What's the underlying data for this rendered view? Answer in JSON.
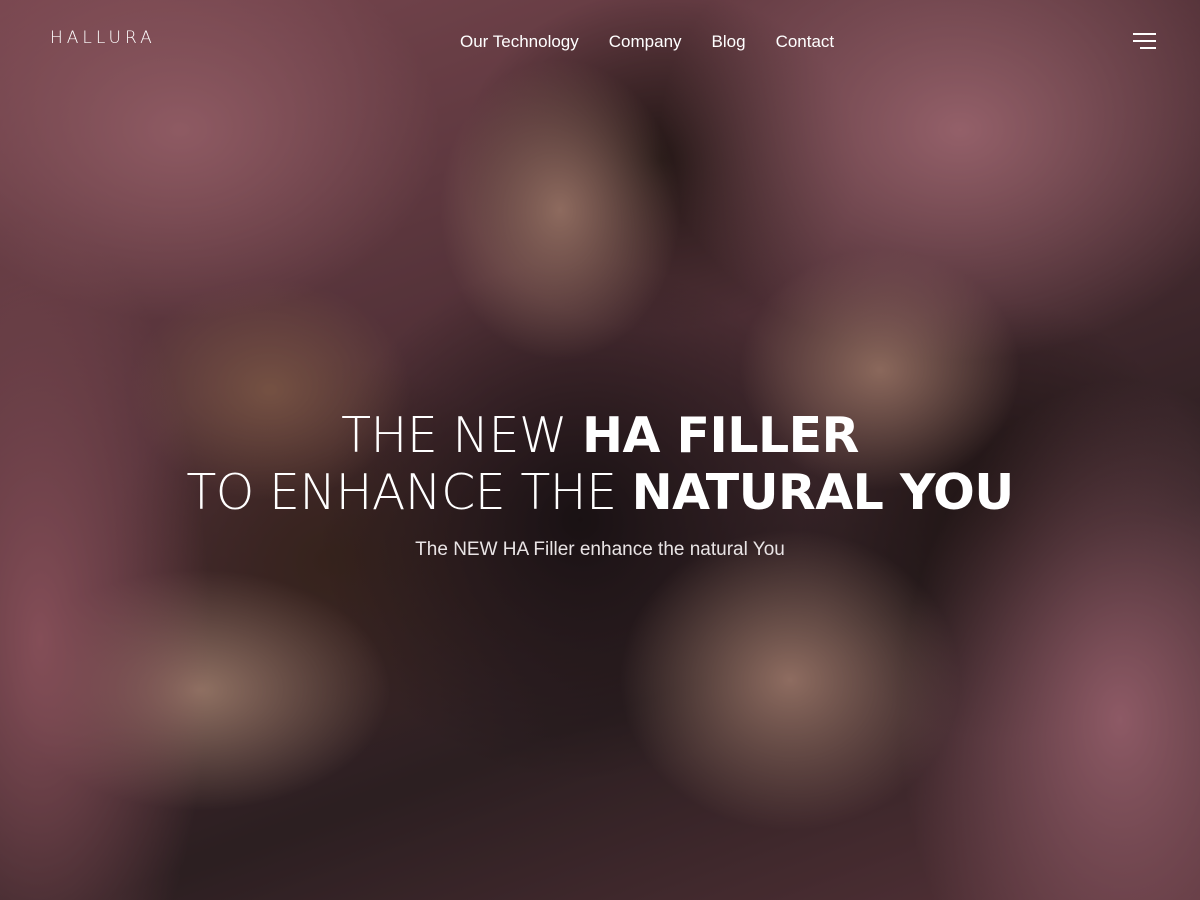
{
  "brand": {
    "logo_text": "HALLURA"
  },
  "nav": {
    "items": [
      {
        "label": "Our Technology"
      },
      {
        "label": "Company"
      },
      {
        "label": "Blog"
      },
      {
        "label": "Contact"
      }
    ],
    "menu_icon": "hamburger-menu-icon"
  },
  "hero": {
    "line1_light": "THE NEW ",
    "line1_bold": "HA FILLER",
    "line2_light": "TO ENHANCE THE ",
    "line2_bold": "NATURAL YOU",
    "subtitle": "The NEW HA Filler enhance the natural You",
    "background_tint": "#d98a96"
  }
}
